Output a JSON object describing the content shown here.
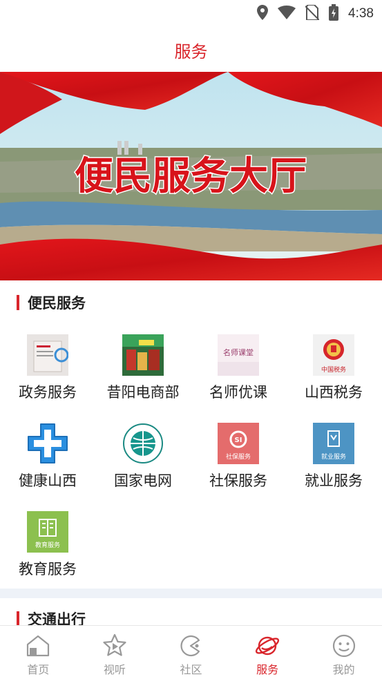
{
  "status_bar": {
    "time": "4:38"
  },
  "header": {
    "title": "服务"
  },
  "banner": {
    "caption": "便民服务大厅"
  },
  "section_convenience": {
    "title": "便民服务",
    "items": [
      {
        "label": "政务服务",
        "icon": "government-service-icon"
      },
      {
        "label": "昔阳电商部",
        "icon": "ecommerce-icon"
      },
      {
        "label": "名师优课",
        "icon": "famous-teacher-icon",
        "icon_text": "名师课堂"
      },
      {
        "label": "山西税务",
        "icon": "tax-emblem-icon",
        "icon_text": "中国税务"
      },
      {
        "label": "健康山西",
        "icon": "health-cross-icon"
      },
      {
        "label": "国家电网",
        "icon": "state-grid-icon"
      },
      {
        "label": "社保服务",
        "icon": "social-security-icon",
        "icon_text": "社保服务"
      },
      {
        "label": "就业服务",
        "icon": "employment-icon",
        "icon_text": "就业服务"
      },
      {
        "label": "教育服务",
        "icon": "education-icon",
        "icon_text": "教育服务"
      }
    ]
  },
  "section_traffic": {
    "title": "交通出行"
  },
  "tabbar": {
    "tabs": [
      {
        "label": "首页",
        "icon": "home-icon"
      },
      {
        "label": "视听",
        "icon": "video-play-icon"
      },
      {
        "label": "社区",
        "icon": "community-icon"
      },
      {
        "label": "服务",
        "icon": "service-planet-icon",
        "active": true
      },
      {
        "label": "我的",
        "icon": "profile-smile-icon"
      }
    ]
  },
  "colors": {
    "accent": "#d9262c",
    "inactive": "#999999",
    "band": "#eef2f8"
  }
}
